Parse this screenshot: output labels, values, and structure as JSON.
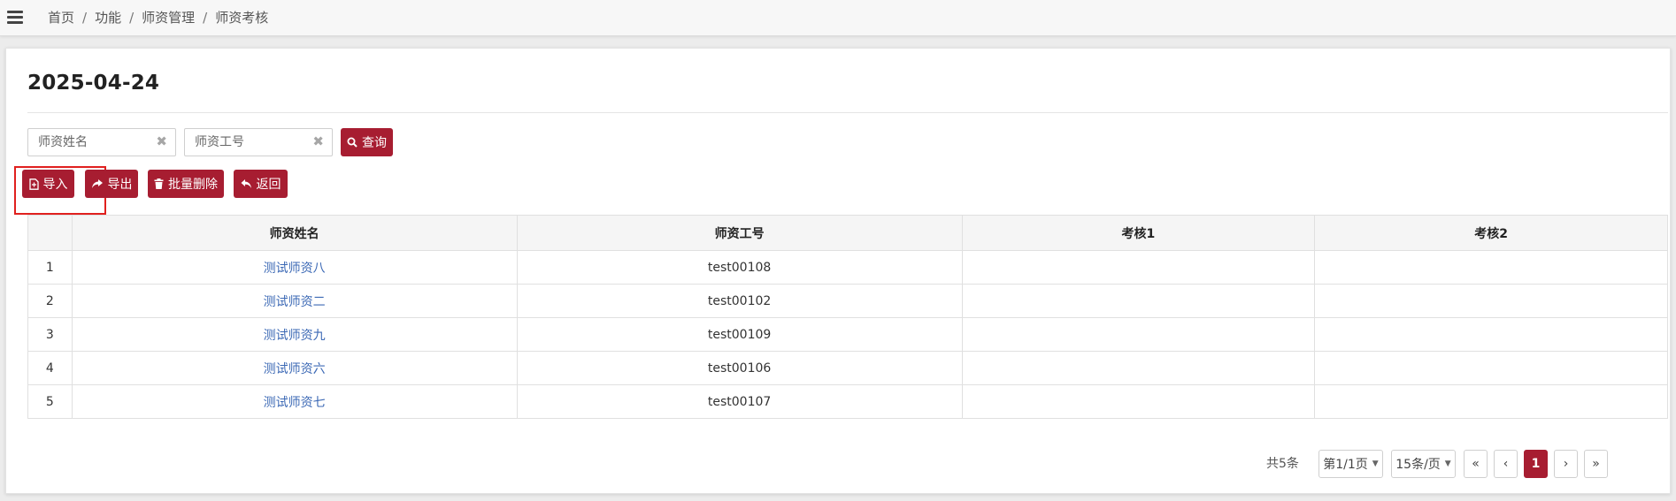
{
  "breadcrumb": {
    "items": [
      "首页",
      "功能",
      "师资管理",
      "师资考核"
    ],
    "separator": "/"
  },
  "page": {
    "title": "2025-04-24"
  },
  "search": {
    "name_placeholder": "师资姓名",
    "id_placeholder": "师资工号",
    "clear_symbol": "✖",
    "query_label": "查询"
  },
  "toolbar": {
    "import_label": "导入",
    "export_label": "导出",
    "batch_delete_label": "批量删除",
    "back_label": "返回"
  },
  "table": {
    "headers": [
      "",
      "师资姓名",
      "师资工号",
      "考核1",
      "考核2"
    ],
    "rows": [
      {
        "index": "1",
        "name": "测试师资八",
        "id": "test00108",
        "exam1": "",
        "exam2": ""
      },
      {
        "index": "2",
        "name": "测试师资二",
        "id": "test00102",
        "exam1": "",
        "exam2": ""
      },
      {
        "index": "3",
        "name": "测试师资九",
        "id": "test00109",
        "exam1": "",
        "exam2": ""
      },
      {
        "index": "4",
        "name": "测试师资六",
        "id": "test00106",
        "exam1": "",
        "exam2": ""
      },
      {
        "index": "5",
        "name": "测试师资七",
        "id": "test00107",
        "exam1": "",
        "exam2": ""
      }
    ]
  },
  "pagination": {
    "total": "共5条",
    "page_info": "第1/1页",
    "page_size": "15条/页",
    "first": "«",
    "prev": "‹",
    "current": "1",
    "next": "›",
    "last": "»"
  },
  "colors": {
    "accent": "#a71d31",
    "link": "#3c69b5",
    "highlight": "#e0201e"
  },
  "icons": {
    "menu": "hamburger-icon",
    "query": "search-icon",
    "import": "file-import-icon",
    "export": "share-arrow-icon",
    "batch_delete": "trash-icon",
    "back": "reply-arrow-icon"
  }
}
